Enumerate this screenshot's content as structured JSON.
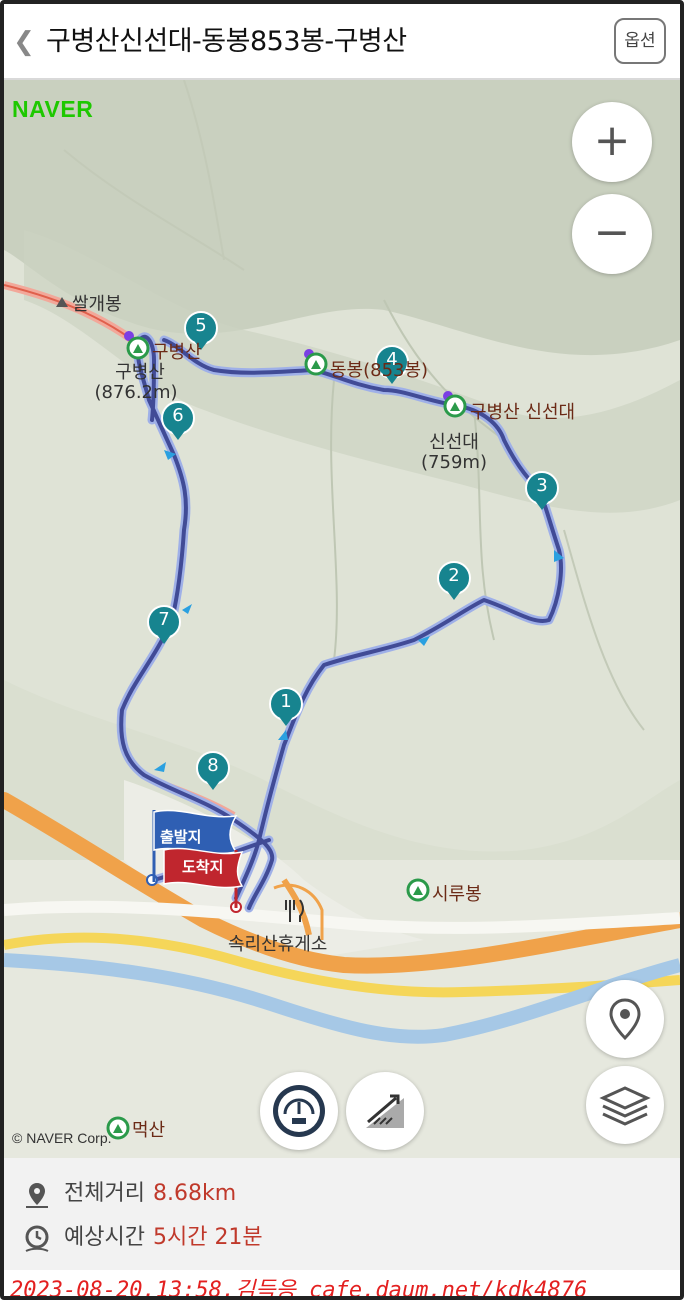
{
  "header": {
    "back_icon": "chevron-left-icon",
    "title": "구병산신선대-동봉853봉-구병산",
    "options_label": "옵션"
  },
  "map": {
    "brand": "NAVER",
    "copyright": "© NAVER Corp.",
    "zoom_in": "+",
    "zoom_out": "−",
    "labels": {
      "ssalgaebong": "쌀개봉",
      "gubyeongsan_short": "구병산",
      "gubyeongsan_height": "(876.2m)",
      "dongbong": "동봉(853봉)",
      "gubyeongsan_sinseondae": "구병산 신선대",
      "sinseondae": "신선대",
      "sinseondae_height": "(759m)",
      "sirubong": "시루봉",
      "rest_area": "속리산휴게소",
      "meoksan": "먹산",
      "start_flag": "출발지",
      "end_flag": "도착지"
    },
    "waypoints": [
      "1",
      "2",
      "3",
      "4",
      "5",
      "6",
      "7",
      "8"
    ],
    "colors": {
      "route": "#3d4a9c",
      "waypoint": "#17848f",
      "start_flag": "#2f5fb3",
      "end_flag": "#c0262e",
      "peak_icon": "#2b9a4a"
    },
    "buttons": [
      "location-pin-icon",
      "layers-icon",
      "speedometer-icon",
      "elevation-profile-icon"
    ]
  },
  "summary": {
    "distance_label": "전체거리",
    "distance_value": "8.68km",
    "time_label": "예상시간",
    "time_value": "5시간 21분"
  },
  "watermark": "2023-08-20,13:58,김득응 cafe.daum.net/kdk4876"
}
